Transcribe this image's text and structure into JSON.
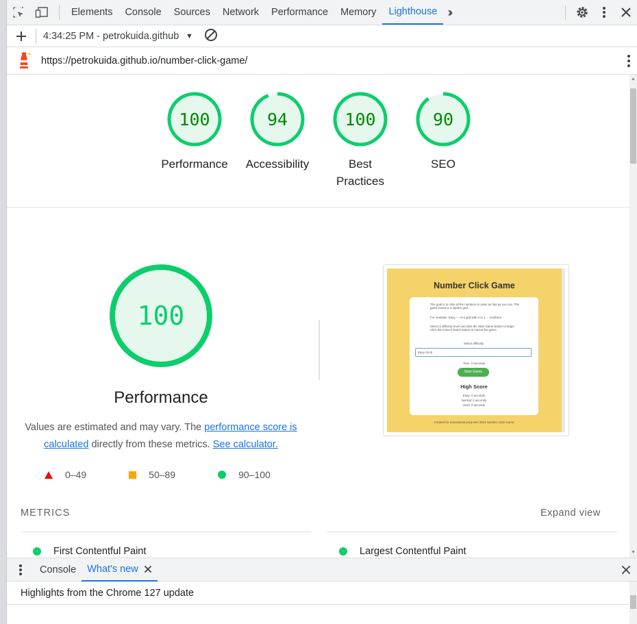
{
  "devtools": {
    "tabs": [
      {
        "label": "Elements"
      },
      {
        "label": "Console"
      },
      {
        "label": "Sources"
      },
      {
        "label": "Network"
      },
      {
        "label": "Performance"
      },
      {
        "label": "Memory"
      },
      {
        "label": "Lighthouse",
        "active": true
      }
    ],
    "more_tabs_icon": "chevron-double-right-icon",
    "inspect_icon": "inspect-element-icon",
    "device_icon": "device-toolbar-icon",
    "settings_icon": "gear-icon",
    "menu_icon": "kebab-menu-icon",
    "close_icon": "close-icon"
  },
  "lighthouse_toolbar": {
    "add_icon": "plus-icon",
    "report_selector": "4:34:25 PM - petrokuida.github",
    "clear_icon": "block-icon"
  },
  "url_bar": {
    "logo_icon": "lighthouse-icon",
    "url": "https://petrokuida.github.io/number-click-game/",
    "menu_icon": "kebab-menu-icon"
  },
  "scores": [
    {
      "label": "Performance",
      "score": 100
    },
    {
      "label": "Accessibility",
      "score": 94
    },
    {
      "label": "Best Practices",
      "score": 100
    },
    {
      "label": "SEO",
      "score": 90
    }
  ],
  "performance_section": {
    "score": 100,
    "title": "Performance",
    "desc_prefix": "Values are estimated and may vary. The ",
    "link_score": "performance score is calculated",
    "desc_middle": " directly from these metrics. ",
    "link_calc": "See calculator.",
    "legend": [
      {
        "shape": "triangle",
        "color": "#eb0f00",
        "range": "0–49"
      },
      {
        "shape": "square",
        "color": "#ffa400",
        "range": "50–89"
      },
      {
        "shape": "circle",
        "color": "#0cce6b",
        "range": "90–100"
      }
    ]
  },
  "screenshot": {
    "title": "Number Click Game",
    "p1": "The goal is to click all the numbers in order as fast as you can. The game board is a square grid.",
    "p2": "For example: Easy — 4×4 grid with 4 to 1 ... numbers.",
    "p3": "Select a difficulty level and click the Start Game button to begin. Click the Cancel Game button to cancel the game.",
    "select_label": "Select difficulty:",
    "select_value": "Easy (4×4)",
    "time_label": "Time: 0 seconds",
    "button": "Start Game",
    "high_score_title": "High Score",
    "high_scores": [
      "Easy: 0 seconds",
      "Normal: 0 seconds",
      "Hard: 0 seconds"
    ],
    "footer": "Created for educational purposes 2024 Number Click Game."
  },
  "metrics": {
    "header": "METRICS",
    "expand": "Expand view",
    "items": [
      "First Contentful Paint",
      "Largest Contentful Paint"
    ]
  },
  "drawer": {
    "menu_icon": "kebab-menu-icon",
    "tabs": [
      {
        "label": "Console"
      },
      {
        "label": "What's new",
        "active": true
      }
    ],
    "highlight": "Highlights from the Chrome 127 update"
  },
  "colors": {
    "pass_ring": "#0cce6b",
    "pass_fill": "#e6f8ee",
    "pass_text": "#008800",
    "accent": "#1a73e8"
  }
}
